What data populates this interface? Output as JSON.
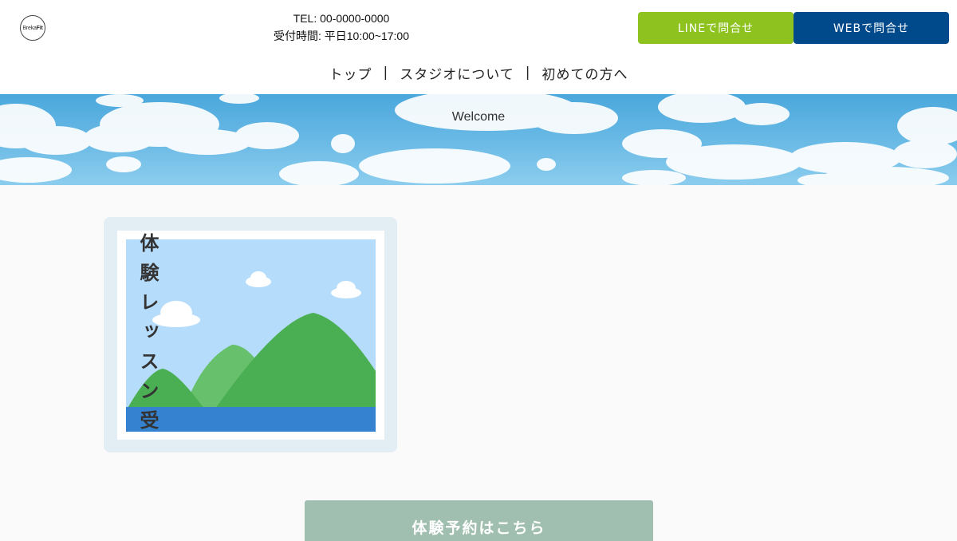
{
  "header": {
    "logo": {
      "prefix": "Breka",
      "suffix": "Fit"
    },
    "tel": "TEL: 00-0000-0000",
    "hours": "受付時間: 平日10:00~17:00",
    "line_button": "LINEで問合せ",
    "web_button": "WEBで問合せ"
  },
  "nav": {
    "items": [
      {
        "label": "トップ"
      },
      {
        "label": "スタジオについて"
      },
      {
        "label": "初めての方へ"
      }
    ],
    "separator": "|"
  },
  "hero": {
    "title": "Welcome"
  },
  "main": {
    "card_title": "体験レッスン受",
    "cta_label": "体験予約はこちら"
  },
  "colors": {
    "line_green": "#8dc21f",
    "web_blue": "#004a8c",
    "cta_green": "#a0bfb0",
    "card_frame": "#e3edf4"
  },
  "icons": {
    "card_image": "landscape-placeholder-icon"
  }
}
